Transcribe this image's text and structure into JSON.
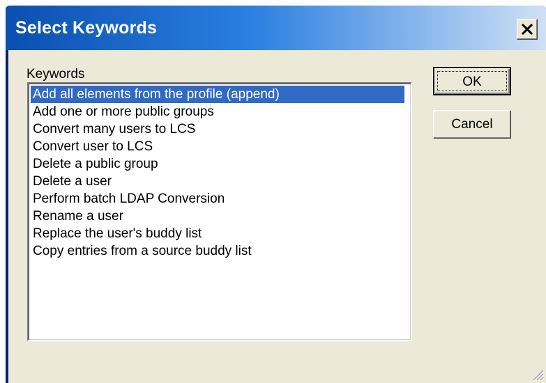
{
  "window": {
    "title": "Select Keywords",
    "close_icon": "close-x-icon"
  },
  "keywords": {
    "label": "Keywords",
    "selected_index": 0,
    "items": [
      "Add all elements from the profile (append)",
      "Add one or more public groups",
      "Convert many users to LCS",
      "Convert user to LCS",
      "Delete a public group",
      "Delete a user",
      "Perform batch LDAP Conversion",
      "Rename a user",
      "Replace the user's buddy list",
      "Copy entries from a source buddy list"
    ]
  },
  "buttons": {
    "ok": "OK",
    "cancel": "Cancel"
  },
  "colors": {
    "selection": "#316ac5",
    "dialog_background": "#ece9d8",
    "title_bar": "#0b4fb0"
  }
}
